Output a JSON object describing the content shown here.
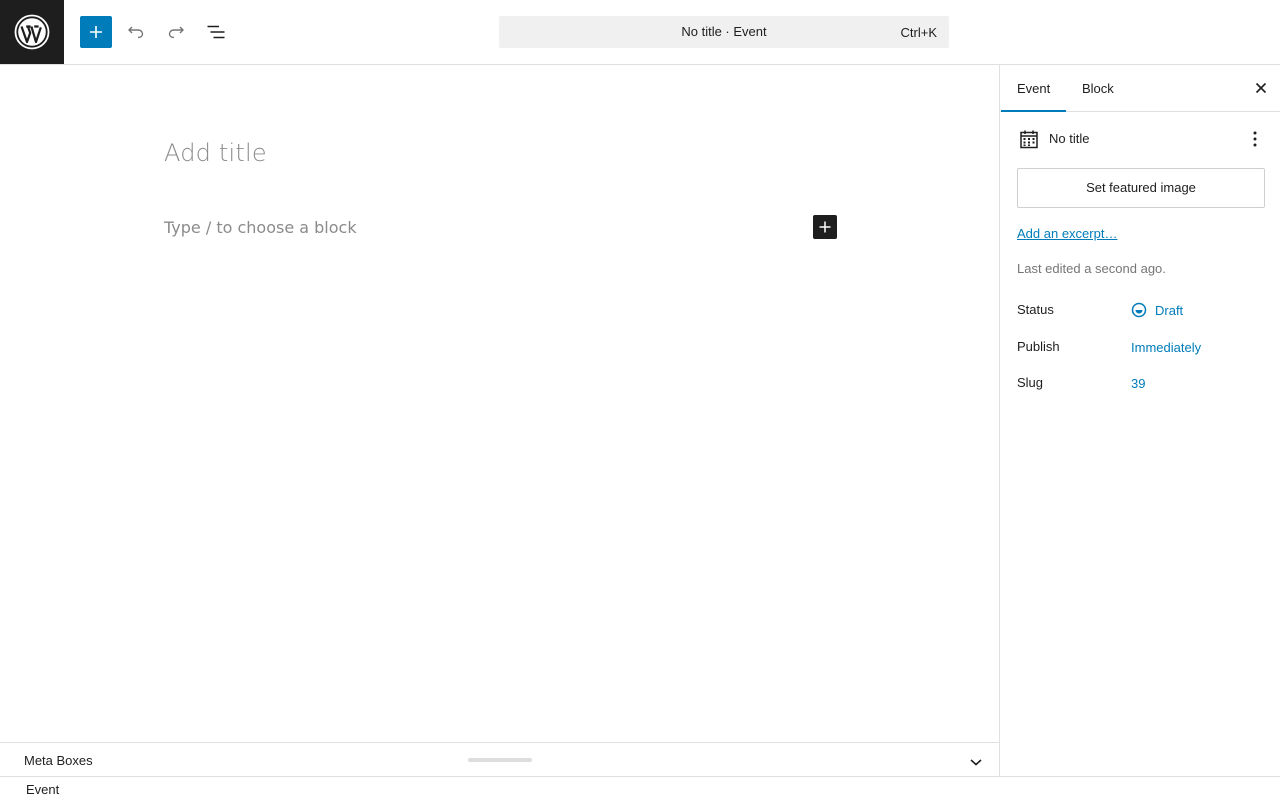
{
  "header": {
    "logo_icon": "wordpress-logo-icon",
    "inserter_icon": "plus-icon",
    "undo_icon": "undo-icon",
    "redo_icon": "redo-icon",
    "list_view_icon": "list-view-icon",
    "command_bar": {
      "title": "No title · Event",
      "shortcut": "Ctrl+K"
    }
  },
  "editor": {
    "title_placeholder": "Add title",
    "block_placeholder": "Type / to choose a block",
    "block_inserter_icon": "plus-icon"
  },
  "sidebar": {
    "tabs": [
      {
        "label": "Event",
        "active": true
      },
      {
        "label": "Block",
        "active": false
      }
    ],
    "close_icon": "close-icon",
    "post_card": {
      "icon": "calendar-icon",
      "title": "No title",
      "more_icon": "more-vertical-icon"
    },
    "featured_image_label": "Set featured image",
    "excerpt_link": "Add an excerpt…",
    "last_edited": "Last edited a second ago.",
    "rows": {
      "status": {
        "label": "Status",
        "value": "Draft",
        "icon": "draft-status-icon"
      },
      "publish": {
        "label": "Publish",
        "value": "Immediately"
      },
      "slug": {
        "label": "Slug",
        "value": "39"
      }
    }
  },
  "metabox": {
    "label": "Meta Boxes",
    "toggle_icon": "chevron-down-icon"
  },
  "footer": {
    "breadcrumb": "Event"
  },
  "colors": {
    "accent": "#007cba",
    "dark": "#1e1e1e",
    "placeholder": "#8b8b8b",
    "muted": "#757575",
    "border": "#e0e0e0"
  }
}
